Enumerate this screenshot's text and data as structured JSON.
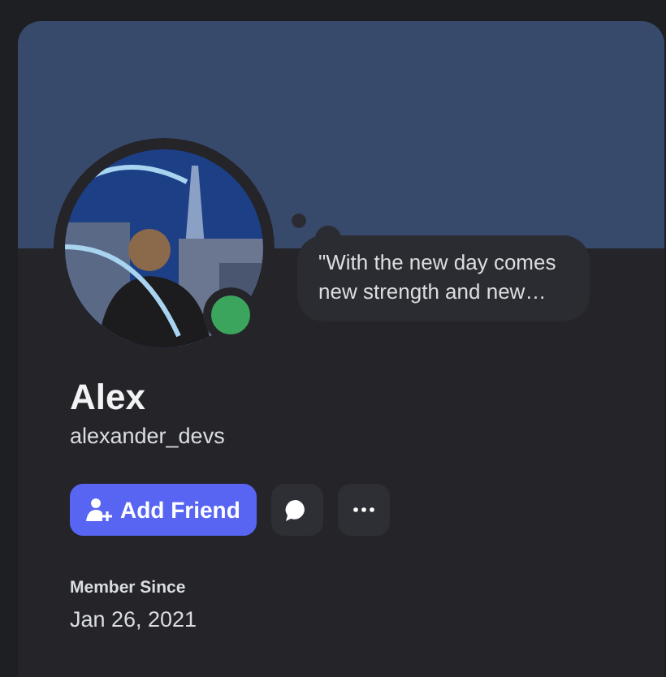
{
  "profile": {
    "display_name": "Alex",
    "username": "alexander_devs",
    "status_dot": {
      "color": "#3ba55d"
    },
    "custom_status": "\"With the new day comes new strength and new…"
  },
  "actions": [
    {
      "kind": "primary",
      "label": "Add Friend"
    },
    {
      "kind": "message"
    },
    {
      "kind": "more"
    }
  ],
  "member_since": {
    "label": "Member Since",
    "value": "Jan 26, 2021"
  }
}
